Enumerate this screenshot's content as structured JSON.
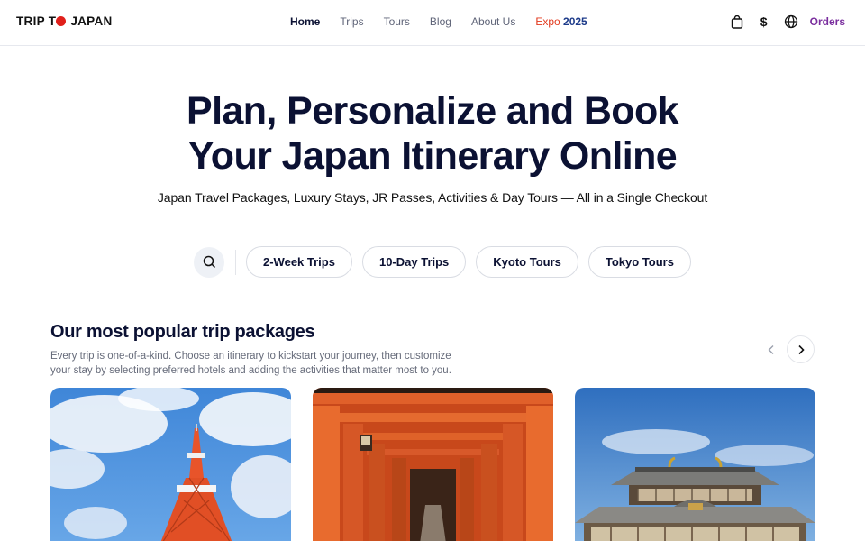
{
  "header": {
    "logo_part1": "TRIP T",
    "logo_part2": "JAPAN",
    "nav": [
      {
        "label": "Home",
        "active": true
      },
      {
        "label": "Trips"
      },
      {
        "label": "Tours"
      },
      {
        "label": "Blog"
      },
      {
        "label": "About Us"
      }
    ],
    "expo_label_a": "Expo",
    "expo_label_b": "2025",
    "icons": [
      "shopping-bag-icon",
      "dollar-icon",
      "globe-icon"
    ],
    "currency_symbol": "$",
    "orders_label": "Orders",
    "colors": {
      "logo_dot": "#e0201b",
      "expo_a": "#e2391d",
      "expo_b": "#1d3b8a",
      "orders": "#7a2e9e"
    }
  },
  "hero": {
    "title_line1": "Plan, Personalize and Book",
    "title_line2": "Your Japan Itinerary Online",
    "subtitle": "Japan Travel Packages, Luxury Stays, JR Passes, Activities & Day Tours — All in a Single Checkout"
  },
  "quick_links": {
    "search_icon": "search-icon",
    "chips": [
      "2-Week Trips",
      "10-Day Trips",
      "Kyoto Tours",
      "Tokyo Tours"
    ]
  },
  "popular": {
    "title": "Our most popular trip packages",
    "description": "Every trip is one-of-a-kind. Choose an itinerary to kickstart your journey, then customize your stay by selecting preferred hotels and adding the activities that matter most to you.",
    "prev_icon": "chevron-left-icon",
    "next_icon": "chevron-right-icon",
    "cards": [
      {
        "image": "tokyo-tower-photo"
      },
      {
        "image": "torii-gates-photo"
      },
      {
        "image": "temple-photo"
      }
    ]
  }
}
